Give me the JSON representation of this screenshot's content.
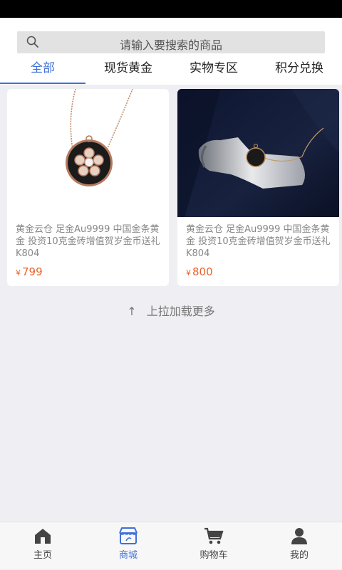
{
  "search": {
    "placeholder": "请输入要搜索的商品",
    "icon": "search-icon"
  },
  "tabs": [
    {
      "label": "全部",
      "active": true
    },
    {
      "label": "现货黄金"
    },
    {
      "label": "实物专区"
    },
    {
      "label": "积分兑换"
    }
  ],
  "products": [
    {
      "title": "黄金云仓 足金Au9999 中国金条黄金 投资10克金砖增值贺岁金币送礼K804",
      "currency": "¥",
      "price": "799"
    },
    {
      "title": "黄金云仓 足金Au9999 中国金条黄金 投资10克金砖增值贺岁金币送礼K804",
      "currency": "¥",
      "price": "800"
    }
  ],
  "load_more": {
    "arrow": "↑",
    "text": "上拉加载更多"
  },
  "bottom_nav": [
    {
      "label": "主页",
      "icon": "home-icon"
    },
    {
      "label": "商城",
      "icon": "shop-icon",
      "active": true
    },
    {
      "label": "购物车",
      "icon": "cart-icon"
    },
    {
      "label": "我的",
      "icon": "user-icon"
    }
  ],
  "colors": {
    "accent": "#3e6fd8",
    "price": "#e8642c"
  }
}
